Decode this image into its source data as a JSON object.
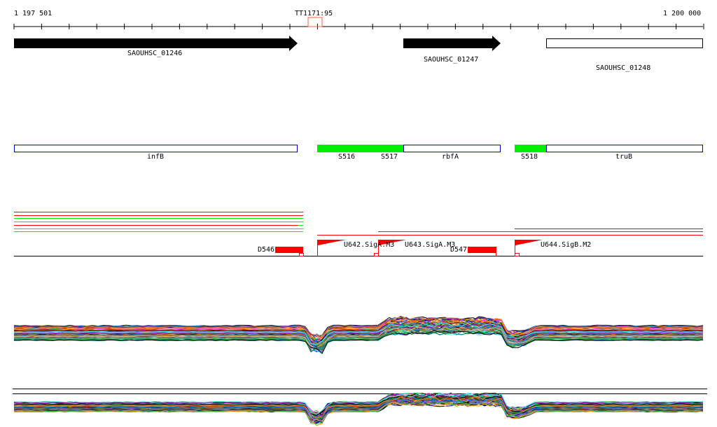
{
  "ruler": {
    "start": "1 197 501",
    "end": "1 200 000",
    "cursor": "TT1171:95"
  },
  "genes": [
    {
      "name": "SAOUHSC_01246",
      "strand": "+",
      "style": "filled"
    },
    {
      "name": "SAOUHSC_01247",
      "strand": "+",
      "style": "filled"
    },
    {
      "name": "SAOUHSC_01248",
      "strand": "",
      "style": "outline"
    }
  ],
  "features": [
    {
      "name": "infB"
    },
    {
      "name": "S516"
    },
    {
      "name": "S517"
    },
    {
      "name": "rbfA"
    },
    {
      "name": "S518"
    },
    {
      "name": "truB"
    }
  ],
  "elements": [
    {
      "name": "D546"
    },
    {
      "name": "U642.SigA.M3"
    },
    {
      "name": "U643.SigA.M3"
    },
    {
      "name": "D547"
    },
    {
      "name": "U644.SigB.M2"
    }
  ],
  "colors": {
    "gene": "#000000",
    "feature_outline": "#0000cc",
    "feature_fill": "#00ee00",
    "element": "#ff0000",
    "cursor": "#ff6040"
  }
}
